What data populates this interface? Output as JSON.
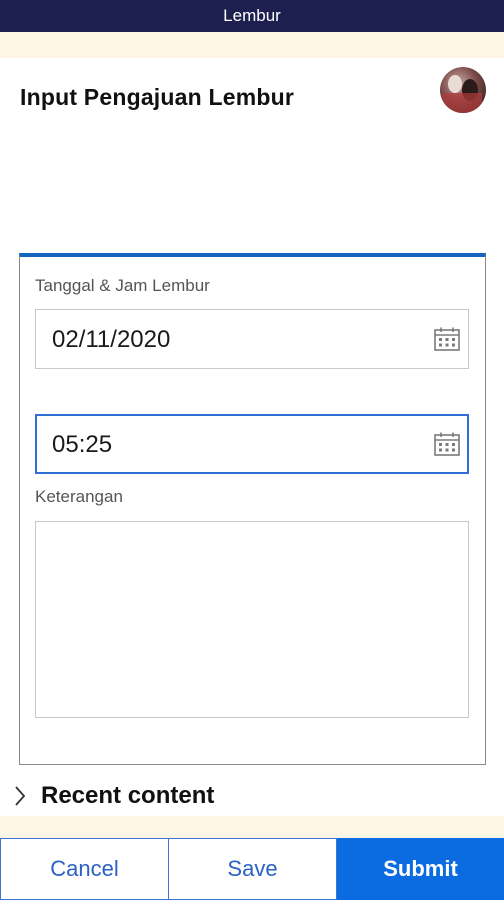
{
  "app_bar": {
    "title": "Lembur"
  },
  "header": {
    "title": "Input Pengajuan Lembur"
  },
  "form": {
    "date_time_label": "Tanggal & Jam Lembur",
    "date_value": "02/11/2020",
    "time_value": "05:25",
    "notes_label": "Keterangan",
    "notes_value": ""
  },
  "recent": {
    "label": "Recent content"
  },
  "footer": {
    "cancel_label": "Cancel",
    "save_label": "Save",
    "submit_label": "Submit"
  },
  "colors": {
    "topbar": "#1c1f4f",
    "accent": "#1565c0",
    "submit": "#0a6ce0",
    "cream": "#fdf6e6"
  },
  "icons": {
    "date_picker": "calendar-icon",
    "time_picker": "calendar-icon",
    "recent_toggle": "chevron-right-icon",
    "avatar": "user-avatar"
  }
}
